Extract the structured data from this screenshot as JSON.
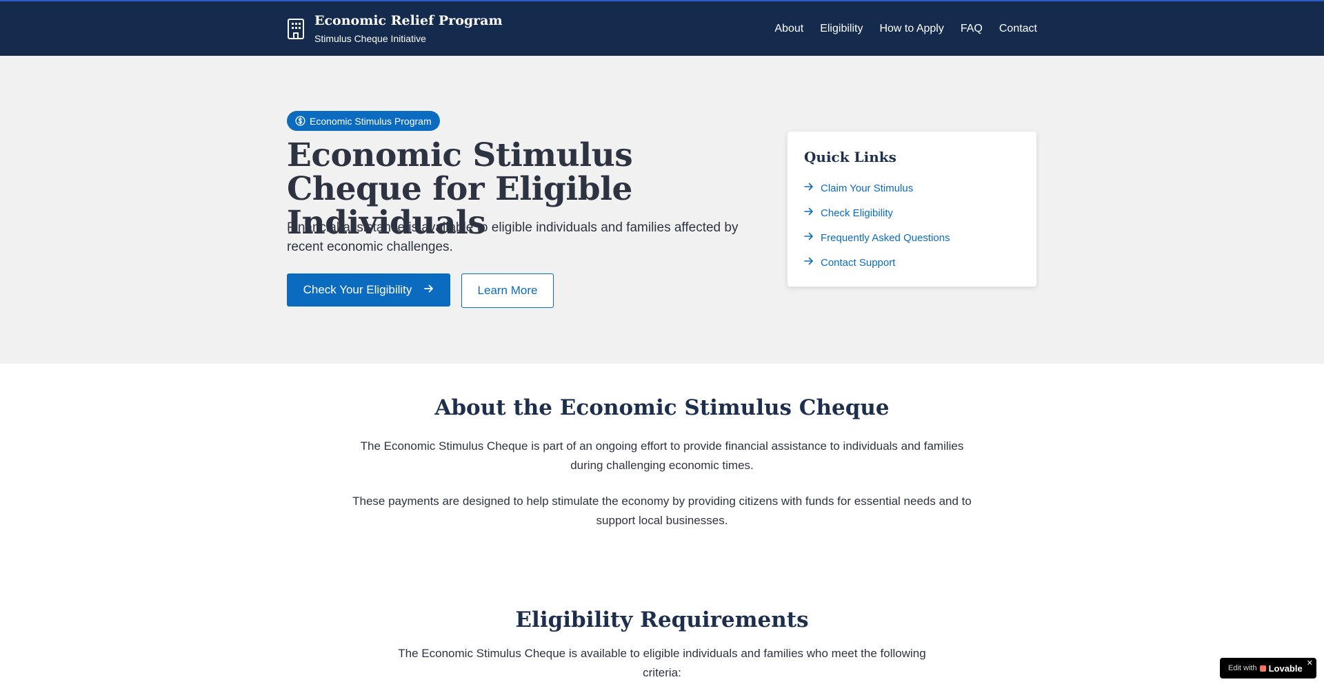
{
  "header": {
    "title": "Economic Relief Program",
    "subtitle": "Stimulus Cheque Initiative",
    "nav": [
      "About",
      "Eligibility",
      "How to Apply",
      "FAQ",
      "Contact"
    ]
  },
  "hero": {
    "badge": "Economic Stimulus Program",
    "title": "Economic Stimulus Cheque for Eligible Individuals",
    "description": "Financial assistance is available to eligible individuals and families affected by recent economic challenges.",
    "primary_button": "Check Your Eligibility",
    "secondary_button": "Learn More"
  },
  "quick_links": {
    "title": "Quick Links",
    "items": [
      "Claim Your Stimulus",
      "Check Eligibility",
      "Frequently Asked Questions",
      "Contact Support"
    ]
  },
  "about": {
    "title": "About the Economic Stimulus Cheque",
    "p1": "The Economic Stimulus Cheque is part of an ongoing effort to provide financial assistance to individuals and families during challenging economic times.",
    "p2": "These payments are designed to help stimulate the economy by providing citizens with funds for essential needs and to support local businesses."
  },
  "eligibility": {
    "title": "Eligibility Requirements",
    "intro": "The Economic Stimulus Cheque is available to eligible individuals and families who meet the following criteria:"
  },
  "badge_widget": {
    "prefix": "Edit with",
    "brand": "Lovable",
    "close": "✕"
  },
  "colors": {
    "header_bg": "#152b4e",
    "accent": "#0b6bbf",
    "hero_bg": "#f1f1f2",
    "heading": "#1d2f4c"
  },
  "icons": {
    "brand": "building-icon",
    "badge": "dollar-circle-icon",
    "arrow": "arrow-right-icon"
  }
}
